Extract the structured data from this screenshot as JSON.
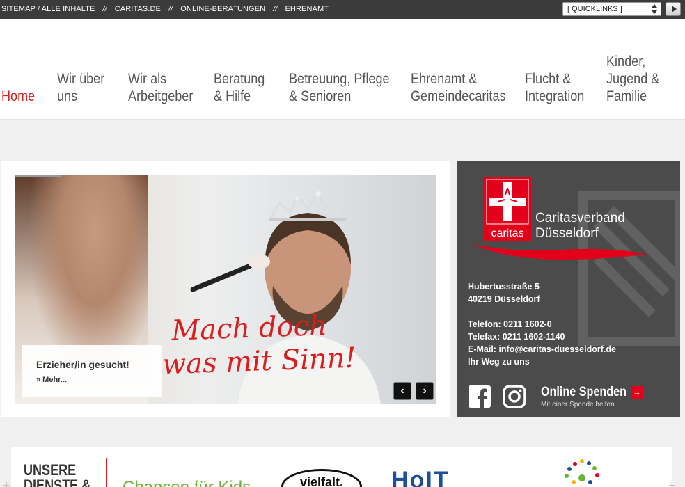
{
  "topbar": {
    "links": [
      "SITEMAP / ALLE INHALTE",
      "CARITAS.DE",
      "ONLINE-BERATUNGEN",
      "EHRENAMT"
    ],
    "separator": "//",
    "quicklinks_selected": "[ QUICKLINKS ]"
  },
  "nav": {
    "items": [
      {
        "line1": "Home",
        "line2": "",
        "line3": "",
        "active": true
      },
      {
        "line1": "Wir über",
        "line2": "uns",
        "line3": ""
      },
      {
        "line1": "Wir als",
        "line2": "Arbeitgeber",
        "line3": ""
      },
      {
        "line1": "Beratung",
        "line2": "& Hilfe",
        "line3": ""
      },
      {
        "line1": "Betreuung, Pflege",
        "line2": "& Senioren",
        "line3": ""
      },
      {
        "line1": "Ehrenamt &",
        "line2": "Gemeindecaritas",
        "line3": ""
      },
      {
        "line1": "Flucht &",
        "line2": "Integration",
        "line3": ""
      },
      {
        "line1": "Kinder,",
        "line2": "Jugend &",
        "line3": "Familie"
      }
    ]
  },
  "slider": {
    "slogan_line1": "Mach doch",
    "slogan_line2": "was mit Sinn!",
    "caption_title": "Erzieher/in gesucht!",
    "caption_more": "» Mehr...",
    "prev": "‹",
    "next": "›"
  },
  "contact": {
    "logo_text": "caritas",
    "org_line1": "Caritasverband",
    "org_line2": "Düsseldorf",
    "street": "Hubertusstraße 5",
    "city": "40219 Düsseldorf",
    "phone": "Telefon: 0211 1602-0",
    "fax": "Telefax: 0211 1602-1140",
    "email": "E-Mail: info@caritas-duesseldorf.de",
    "route": "Ihr Weg zu uns",
    "spenden_title": "Online Spenden",
    "spenden_sub": "Mit einer Spende helfen",
    "spenden_arrow": "→"
  },
  "bottom": {
    "dienste_line1": "UNSERE",
    "dienste_line2": "DIENSTE &",
    "chancen": "Chancen für Kids",
    "vielfalt": "vielfalt.",
    "hoit": "HoIT"
  },
  "colors": {
    "caritas_red": "#e2001a",
    "nav_active": "#d81e1e",
    "dark_panel": "#4b4b4b",
    "topbar": "#3b3b3b"
  }
}
